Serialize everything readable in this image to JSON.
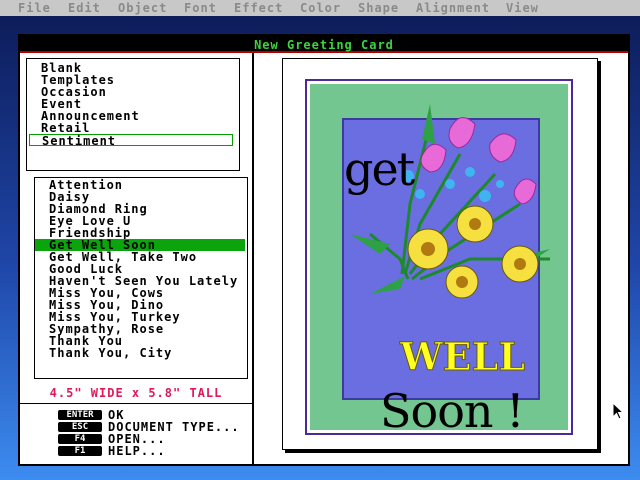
{
  "menu": [
    "File",
    "Edit",
    "Object",
    "Font",
    "Effect",
    "Color",
    "Shape",
    "Alignment",
    "View"
  ],
  "window": {
    "title": "New Greeting Card"
  },
  "categories": {
    "items": [
      "Blank",
      "Templates",
      "Occasion",
      "Event",
      "Announcement",
      "Retail",
      "Sentiment"
    ],
    "selected": "Sentiment"
  },
  "cards": {
    "items": [
      "Attention",
      "Daisy",
      "Diamond Ring",
      "Eye Love U",
      "Friendship",
      "Get Well Soon",
      "Get Well, Take Two",
      "Good Luck",
      "Haven't Seen You Lately",
      "Miss You, Cows",
      "Miss You, Dino",
      "Miss You, Turkey",
      "Sympathy, Rose",
      "Thank You",
      "Thank You, City"
    ],
    "selected": "Get Well Soon"
  },
  "size_text": "4.5\" WIDE x 5.8\" TALL",
  "keys": [
    {
      "key": "ENTER",
      "label": "OK"
    },
    {
      "key": "ESC",
      "label": "DOCUMENT TYPE..."
    },
    {
      "key": "F4",
      "label": "OPEN..."
    },
    {
      "key": "F1",
      "label": "HELP..."
    }
  ],
  "card_text": {
    "line1": "get",
    "line2": "WELL",
    "line3": "Soon !"
  },
  "colors": {
    "accent_green": "#0ca40c",
    "title_green": "#3cd43c",
    "size_red": "#e0185a",
    "card_bg": "#6a6ee0",
    "card_border": "#74c690"
  }
}
